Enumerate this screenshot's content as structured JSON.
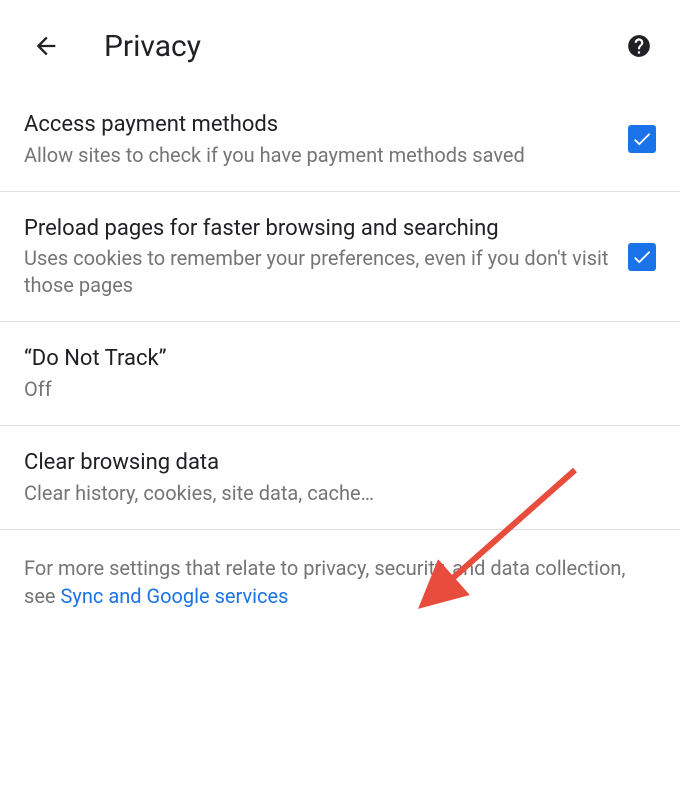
{
  "header": {
    "title": "Privacy"
  },
  "settings": {
    "payment": {
      "title": "Access payment methods",
      "desc": "Allow sites to check if you have payment methods saved"
    },
    "preload": {
      "title": "Preload pages for faster browsing and searching",
      "desc": "Uses cookies to remember your preferences, even if you don't visit those pages"
    },
    "dnt": {
      "title": "“Do Not Track”",
      "desc": "Off"
    },
    "clear": {
      "title": "Clear browsing data",
      "desc": "Clear history, cookies, site data, cache…"
    }
  },
  "footer": {
    "prefix": "For more settings that relate to privacy, security, and data collection, see ",
    "link": "Sync and Google services"
  }
}
